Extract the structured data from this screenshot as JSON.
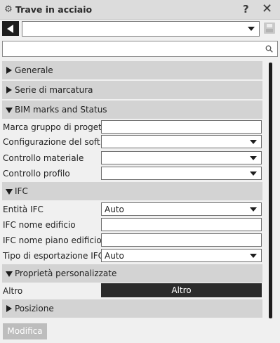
{
  "window": {
    "title": "Trave in acciaio",
    "help_label": "?",
    "close_label": "✕",
    "gear_icon": "⚙"
  },
  "toolbar": {
    "preset_value": "",
    "search_value": ""
  },
  "sections": {
    "generale": "Generale",
    "serie_marcatura": "Serie di marcatura",
    "bim_marks": "BIM marks and Status",
    "ifc": "IFC",
    "proprieta": "Proprietà personalizzate",
    "posizione": "Posizione"
  },
  "bim": {
    "marca_gruppo_label": "Marca gruppo di progetto",
    "marca_gruppo_value": "",
    "config_software_label": "Configurazione del soft...",
    "config_software_value": "",
    "controllo_materiale_label": "Controllo materiale",
    "controllo_materiale_value": "",
    "controllo_profilo_label": "Controllo profilo",
    "controllo_profilo_value": ""
  },
  "ifc": {
    "entita_label": "Entità IFC",
    "entita_value": "Auto",
    "nome_edificio_label": "IFC nome edificio",
    "nome_edificio_value": "",
    "nome_piano_label": "IFC nome piano edificio",
    "nome_piano_value": "",
    "tipo_esportazione_label": "Tipo di esportazione IFC",
    "tipo_esportazione_value": "Auto"
  },
  "custom": {
    "altro_label": "Altro",
    "altro_button": "Altro"
  },
  "footer": {
    "modify_label": "Modifica"
  }
}
